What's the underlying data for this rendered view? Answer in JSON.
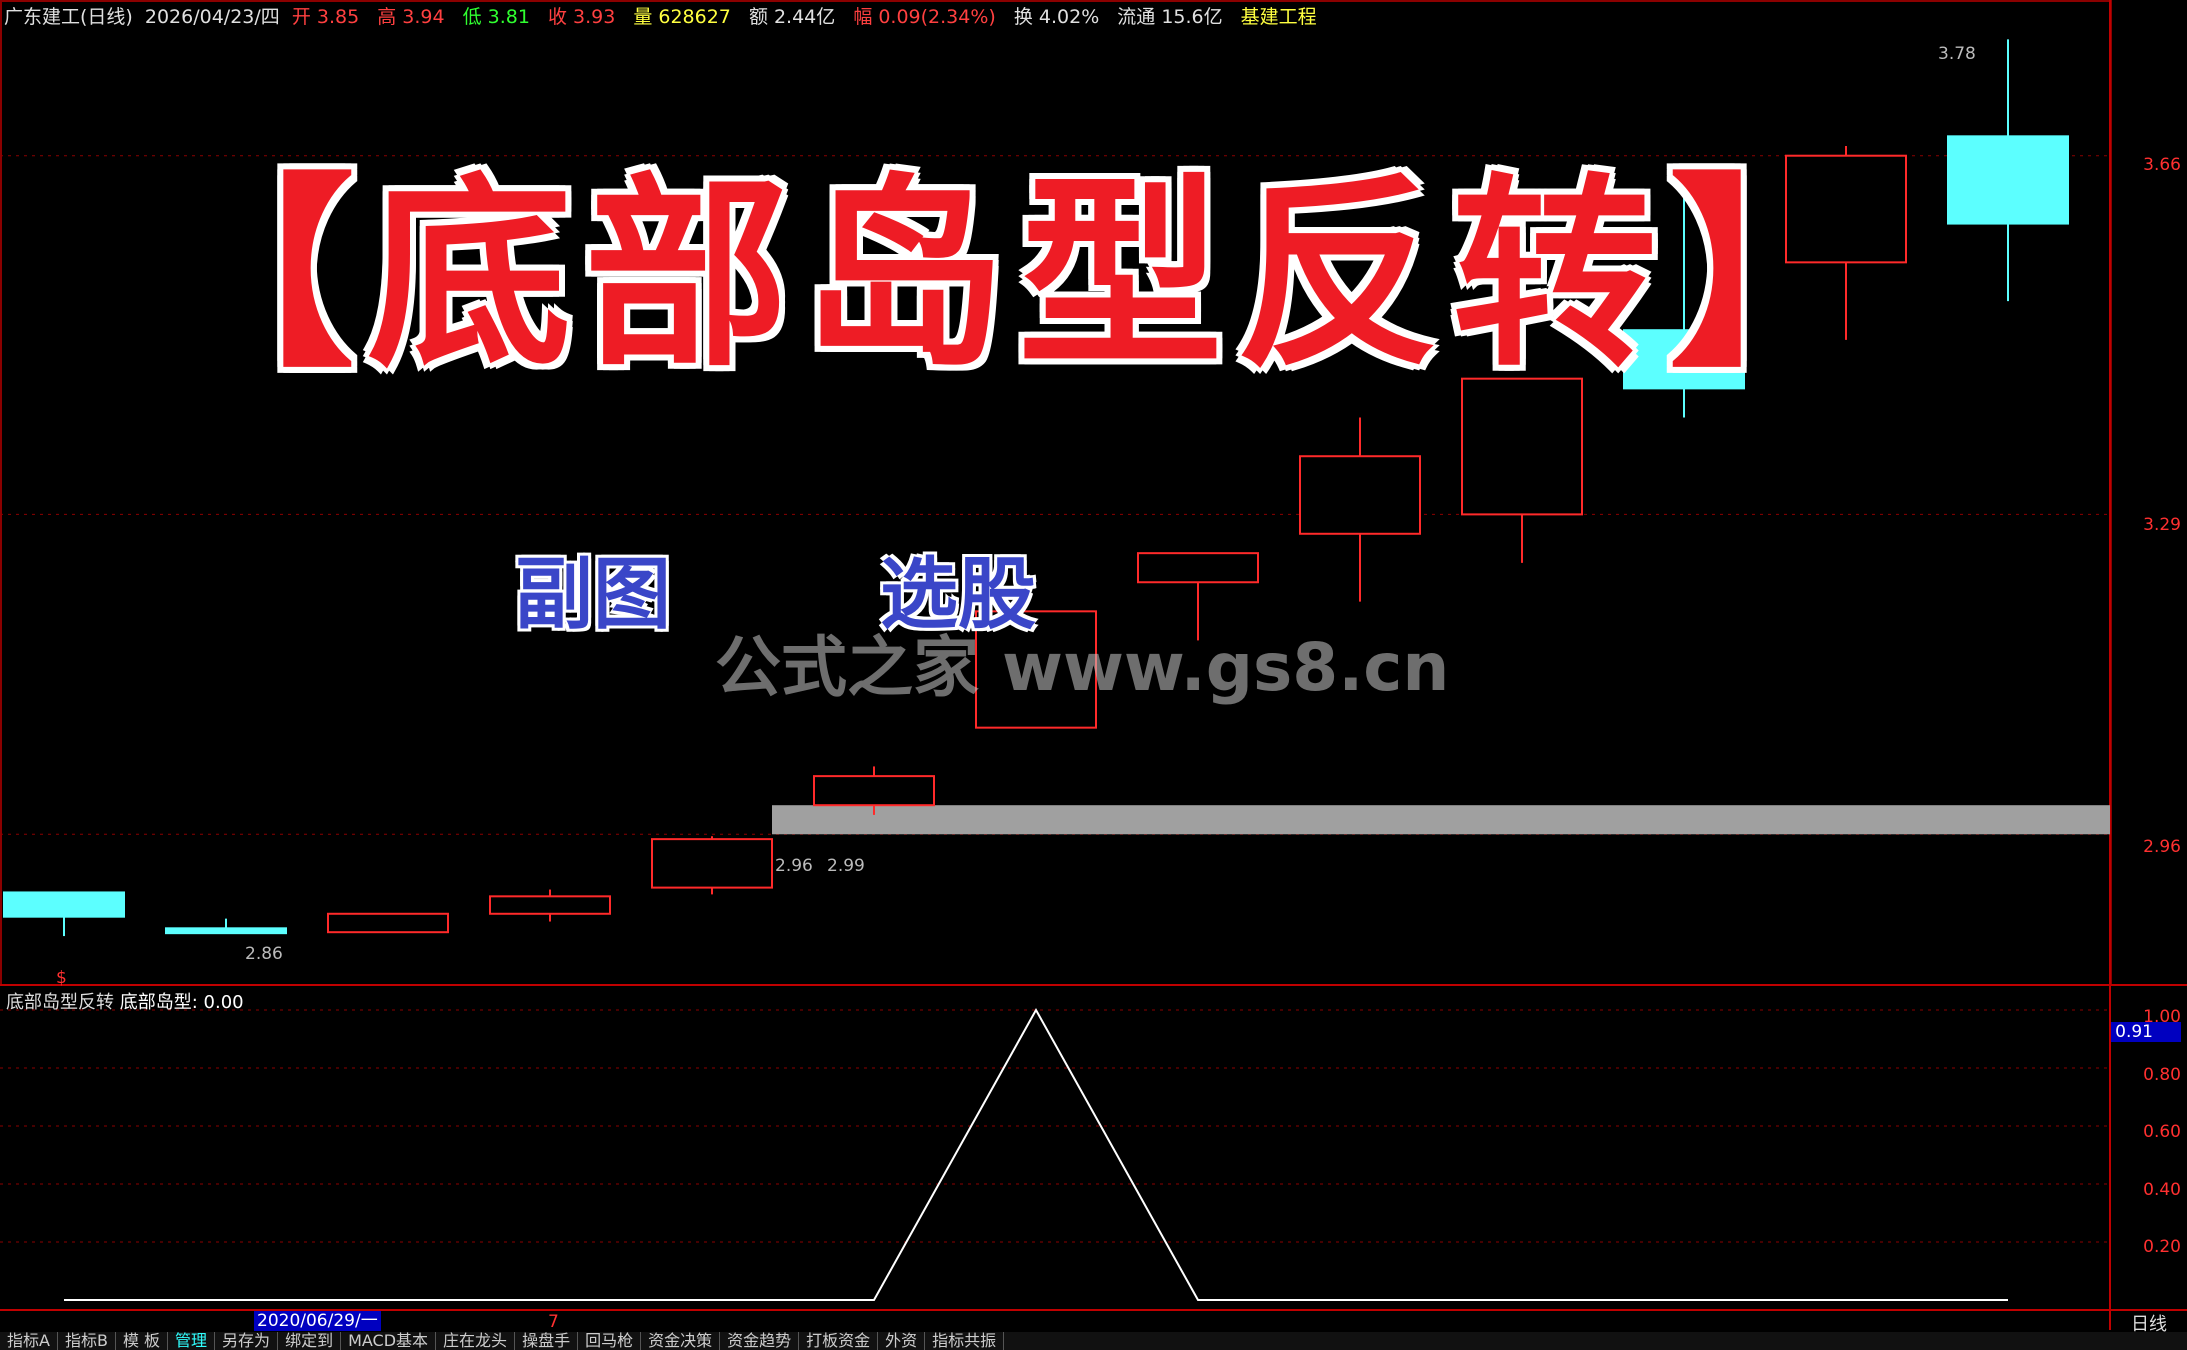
{
  "header": {
    "stock": "广东建工(日线)",
    "date": "2026/04/23/四",
    "open_label": "开",
    "open": "3.85",
    "high_label": "高",
    "high": "3.94",
    "low_label": "低",
    "low": "3.81",
    "close_label": "收",
    "close": "3.93",
    "vol_label": "量",
    "vol": "628627",
    "amount_label": "额",
    "amount": "2.44亿",
    "change_label": "幅",
    "change": "0.09(2.34%)",
    "turnover_label": "换",
    "turnover": "4.02%",
    "float_label": "流通",
    "float": "15.6亿",
    "sector": "基建工程"
  },
  "overlay": {
    "title": "【底部岛型反转】",
    "sub1": "副图",
    "sub2": "选股",
    "watermark": "公式之家 www.gs8.cn"
  },
  "price_axis": {
    "labels": [
      "3.66",
      "3.29",
      "2.96"
    ]
  },
  "annotations": {
    "high": "3.78",
    "low": "2.86",
    "gap_low": "2.96",
    "gap_high": "2.99",
    "marker": "$"
  },
  "indicator": {
    "name": "底部岛型反转",
    "field": "底部岛型:",
    "value": "0.00",
    "axis": [
      "1.00",
      "0.80",
      "0.60",
      "0.40",
      "0.20"
    ],
    "badge": "0.91"
  },
  "bottom": {
    "date": "2020/06/29/一",
    "marker": "7",
    "period": "日线"
  },
  "tabs": [
    "指标A",
    "指标B",
    "模 板",
    "管理",
    "另存为",
    "绑定到",
    "MACD基本",
    "庄在龙头",
    "操盘手",
    "回马枪",
    "资金决策",
    "资金趋势",
    "打板资金",
    "外资",
    "指标共振"
  ],
  "active_tab": 3,
  "colors": {
    "up": "#ff2a2a",
    "down": "#5cffff",
    "bg": "#000000",
    "grid": "#8b0000",
    "gap_band": "#a0a0a0",
    "indicator_line": "#ffffff"
  },
  "chart_data": {
    "type": "candlestick",
    "candles": [
      {
        "o": 2.9,
        "h": 2.9,
        "l": 2.855,
        "c": 2.875,
        "dir": "down"
      },
      {
        "o": 2.863,
        "h": 2.873,
        "l": 2.86,
        "c": 2.858,
        "dir": "down"
      },
      {
        "o": 2.859,
        "h": 2.878,
        "l": 2.859,
        "c": 2.878,
        "dir": "up"
      },
      {
        "o": 2.878,
        "h": 2.903,
        "l": 2.87,
        "c": 2.896,
        "dir": "up"
      },
      {
        "o": 2.905,
        "h": 2.958,
        "l": 2.898,
        "c": 2.955,
        "dir": "up"
      },
      {
        "o": 2.99,
        "h": 3.03,
        "l": 2.98,
        "c": 3.02,
        "dir": "up"
      },
      {
        "o": 3.07,
        "h": 3.19,
        "l": 3.07,
        "c": 3.19,
        "dir": "up"
      },
      {
        "o": 3.22,
        "h": 3.24,
        "l": 3.16,
        "c": 3.25,
        "dir": "up"
      },
      {
        "o": 3.27,
        "h": 3.39,
        "l": 3.2,
        "c": 3.35,
        "dir": "up"
      },
      {
        "o": 3.29,
        "h": 3.43,
        "l": 3.24,
        "c": 3.43,
        "dir": "up"
      },
      {
        "o": 3.48,
        "h": 3.62,
        "l": 3.39,
        "c": 3.42,
        "dir": "down"
      },
      {
        "o": 3.55,
        "h": 3.67,
        "l": 3.47,
        "c": 3.66,
        "dir": "up"
      },
      {
        "o": 3.68,
        "h": 3.78,
        "l": 3.51,
        "c": 3.59,
        "dir": "down"
      }
    ],
    "gap_band": [
      2.96,
      2.99
    ],
    "indicator_series": [
      0,
      0,
      0,
      0,
      0,
      0,
      1,
      0,
      0,
      0,
      0,
      0,
      0
    ],
    "ylim": [
      2.82,
      3.8
    ]
  }
}
